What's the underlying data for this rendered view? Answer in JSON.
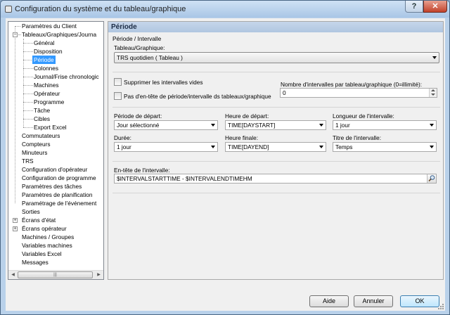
{
  "window": {
    "title": "Configuration du système et du tableau/graphique",
    "help_glyph": "?",
    "close_glyph": "✕"
  },
  "tree": {
    "items": [
      {
        "label": "Paramètres du Client"
      },
      {
        "label": "Tableaux/Graphiques/Journa"
      },
      {
        "label": "Général"
      },
      {
        "label": "Disposition"
      },
      {
        "label": "Période"
      },
      {
        "label": "Colonnes"
      },
      {
        "label": "Journal/Frise chronologic"
      },
      {
        "label": "Machines"
      },
      {
        "label": "Opérateur"
      },
      {
        "label": "Programme"
      },
      {
        "label": "Tâche"
      },
      {
        "label": "Cibles"
      },
      {
        "label": "Export Excel"
      },
      {
        "label": "Commutateurs"
      },
      {
        "label": "Compteurs"
      },
      {
        "label": "Minuteurs"
      },
      {
        "label": "TRS"
      },
      {
        "label": "Configuration d'opérateur"
      },
      {
        "label": "Configuration de programme"
      },
      {
        "label": "Paramètres des tâches"
      },
      {
        "label": "Paramètres de planification"
      },
      {
        "label": "Paramétrage de l'événement"
      },
      {
        "label": "Sorties"
      },
      {
        "label": "Écrans d'état"
      },
      {
        "label": "Écrans opérateur"
      },
      {
        "label": "Machines / Groupes"
      },
      {
        "label": "Variables machines"
      },
      {
        "label": "Variables Excel"
      },
      {
        "label": "Messages"
      }
    ],
    "scroll_left": "◀",
    "scroll_right": "▶",
    "thumb_grip": "|||"
  },
  "panel": {
    "title": "Période",
    "section": "Période / Intervalle",
    "chart_label": "Tableau/Graphique:",
    "chart_value": "TRS quotidien  ( Tableau )",
    "suppress_label": "Supprimer les intervalles vides",
    "no_header_label": "Pas d'en-tête de période/intervalle ds tableaux/graphique",
    "intervals_label": "Nombre d'intervalles par tableau/graphique (0=illimité):",
    "intervals_value": "0",
    "start_period_label": "Période de départ:",
    "start_period_value": "Jour sélectionné",
    "start_time_label": "Heure de départ:",
    "start_time_value": "TIME[DAYSTART]",
    "interval_length_label": "Longueur de l'intervalle:",
    "interval_length_value": "1 jour",
    "duration_label": "Durée:",
    "duration_value": "1 jour",
    "end_time_label": "Heure finale:",
    "end_time_value": "TIME[DAYEND]",
    "interval_title_label": "Titre de l'intervalle:",
    "interval_title_value": "Temps",
    "interval_header_label": "En-tête de l'intervalle:",
    "interval_header_value": "$INTERVALSTARTTIME - $INTERVALENDTIMEHM"
  },
  "buttons": {
    "help": "Aide",
    "cancel": "Annuler",
    "ok": "OK"
  }
}
